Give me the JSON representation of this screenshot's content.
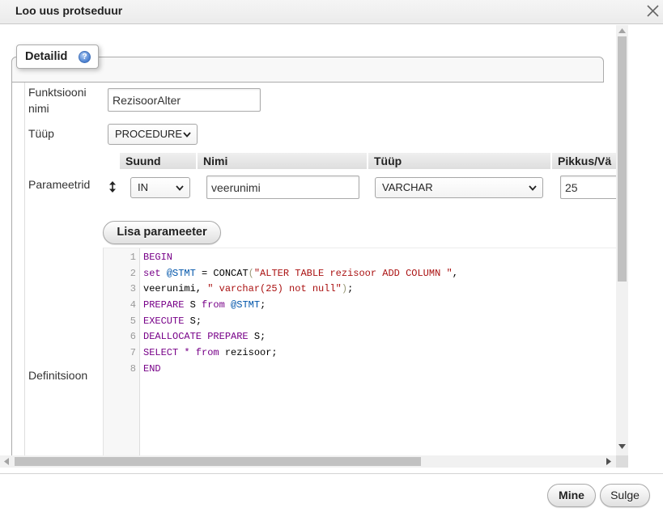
{
  "dialog": {
    "title": "Loo uus protseduur",
    "close_icon": "close-icon"
  },
  "details_tab": {
    "label": "Detailid",
    "help_icon": "help-icon",
    "help_glyph": "?"
  },
  "form": {
    "function_name": {
      "label": "Funktsiooni nimi",
      "value": "RezisoorAlter"
    },
    "type": {
      "label": "Tüüp",
      "value": "PROCEDURE"
    },
    "parameters": {
      "label": "Parameetrid",
      "columns": [
        "Suund",
        "Nimi",
        "Tüüp",
        "Pikkus/Vä"
      ],
      "rows": [
        {
          "drag_icon": "drag-handle-icon",
          "direction": "IN",
          "name": "veerunimi",
          "type": "VARCHAR",
          "length": "25"
        }
      ],
      "add_button": "Lisa parameeter"
    },
    "definition": {
      "label": "Definitsioon",
      "line_numbers": [
        "1",
        "2",
        "3",
        "4",
        "5",
        "6",
        "7",
        "8"
      ],
      "lines": [
        [
          {
            "text": "BEGIN",
            "color": "#770088"
          }
        ],
        [
          {
            "text": "set ",
            "color": "#770088"
          },
          {
            "text": "@STMT",
            "color": "#0055aa"
          },
          {
            "text": " = CONCAT",
            "color": "#000000"
          },
          {
            "text": "(",
            "color": "#999977"
          },
          {
            "text": "\"ALTER TABLE rezisoor ADD COLUMN \"",
            "color": "#aa1111"
          },
          {
            "text": ",",
            "color": "#000000"
          }
        ],
        [
          {
            "text": "veerunimi, ",
            "color": "#000000"
          },
          {
            "text": "\" varchar(25) not null\"",
            "color": "#aa1111"
          },
          {
            "text": ")",
            "color": "#999977"
          },
          {
            "text": ";",
            "color": "#000000"
          }
        ],
        [
          {
            "text": "PREPARE",
            "color": "#770088"
          },
          {
            "text": " S ",
            "color": "#000000"
          },
          {
            "text": "from ",
            "color": "#770088"
          },
          {
            "text": "@STMT",
            "color": "#0055aa"
          },
          {
            "text": ";",
            "color": "#000000"
          }
        ],
        [
          {
            "text": "EXECUTE",
            "color": "#770088"
          },
          {
            "text": " S;",
            "color": "#000000"
          }
        ],
        [
          {
            "text": "DEALLOCATE PREPARE",
            "color": "#770088"
          },
          {
            "text": " S;",
            "color": "#000000"
          }
        ],
        [
          {
            "text": "SELECT * from",
            "color": "#770088"
          },
          {
            "text": " rezisoor;",
            "color": "#000000"
          }
        ],
        [
          {
            "text": "END",
            "color": "#770088"
          }
        ]
      ]
    }
  },
  "footer": {
    "go_button": "Mine",
    "close_button": "Sulge"
  },
  "colors": {
    "help_icon": "#4a7fcf",
    "scrollbar_thumb": "#c1c1c1",
    "border": "#ababab"
  },
  "icons": {
    "select_arrow": "chevron-down-icon",
    "scroll_up": "scroll-up-arrow-icon",
    "scroll_down": "scroll-down-arrow-icon",
    "scroll_left": "scroll-left-arrow-icon",
    "scroll_right": "scroll-right-arrow-icon"
  }
}
